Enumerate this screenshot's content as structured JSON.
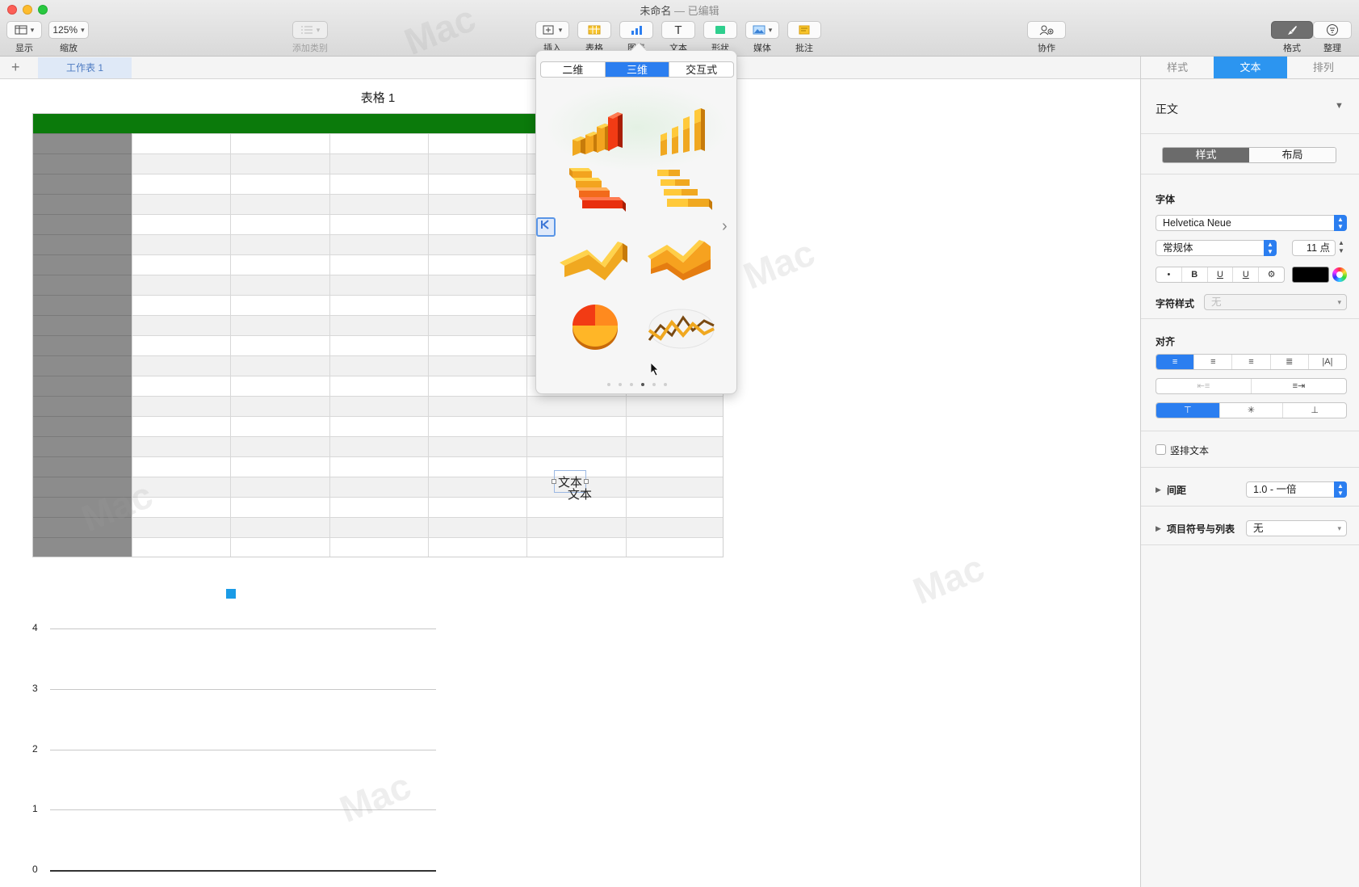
{
  "window": {
    "title": "未命名",
    "title_sep": " — ",
    "status": "已编辑"
  },
  "toolbar": {
    "view_label": "显示",
    "zoom_value": "125%",
    "zoom_label": "缩放",
    "add_category_label": "添加类别",
    "insert_label": "插入",
    "table_label": "表格",
    "chart_label": "图表",
    "text_label": "文本",
    "text_icon": "T",
    "shape_label": "形状",
    "media_label": "媒体",
    "comment_label": "批注",
    "collaborate_label": "协作",
    "format_label": "格式",
    "organize_label": "整理"
  },
  "sheet_tabs": {
    "add": "+",
    "active": "工作表 1"
  },
  "table": {
    "title": "表格 1",
    "header_color": "#0b7a0b",
    "row_header_color": "#8c8c8c",
    "text_box": "文本",
    "text_overlap": "文本"
  },
  "chart_data": {
    "type": "bar",
    "legend_color": "#1a9be6",
    "yticks": [
      "0",
      "1",
      "2",
      "3",
      "4"
    ],
    "ylim": [
      0,
      4
    ],
    "grid": true,
    "series": []
  },
  "chart_popover": {
    "tabs": [
      "二维",
      "三维",
      "交互式"
    ],
    "active_tab": "三维",
    "thumbnails": [
      "3d-column-chart-icon",
      "3d-stacked-column-chart-icon",
      "3d-bar-chart-icon",
      "3d-stacked-bar-chart-icon",
      "3d-area-chart-icon",
      "3d-stacked-area-chart-icon",
      "3d-pie-chart-icon",
      "3d-line-chart-icon"
    ],
    "page_count": 6,
    "current_page": 4,
    "next_arrow": "›"
  },
  "inspector": {
    "tabs": [
      "样式",
      "文本",
      "排列"
    ],
    "active_tab": "文本",
    "paragraph_style": "正文",
    "sub_tabs": [
      "样式",
      "布局"
    ],
    "active_sub_tab": "样式",
    "font_section": "字体",
    "font_family": "Helvetica Neue",
    "font_style": "常规体",
    "font_size": "11 点",
    "format_buttons": [
      "•",
      "B",
      "U",
      "U",
      "⚙"
    ],
    "text_color": "#000000",
    "char_style_label": "字符样式",
    "char_style_value": "无",
    "align_section": "对齐",
    "vertical_text_label": "竖排文本",
    "spacing_label": "间距",
    "spacing_value": "1.0 - 一倍",
    "bullets_label": "项目符号与列表",
    "bullets_value": "无"
  }
}
